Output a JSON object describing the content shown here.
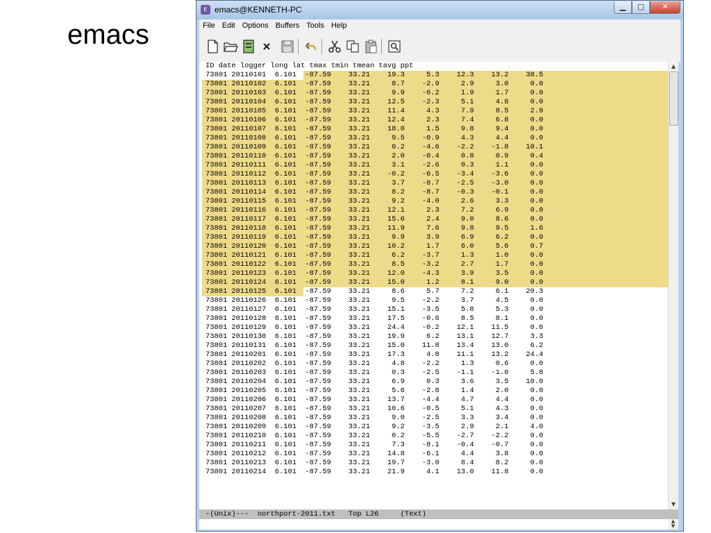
{
  "slide": {
    "title": "emacs"
  },
  "window": {
    "title": "emacs@KENNETH-PC",
    "icon": "emacs-icon",
    "buttons": {
      "minimize": "▁",
      "maximize": "▢",
      "close": "✕"
    }
  },
  "menu": [
    "File",
    "Edit",
    "Options",
    "Buffers",
    "Tools",
    "Help"
  ],
  "toolbar": [
    "new-file-icon",
    "open-folder-icon",
    "dired-icon",
    "close-buffer-icon",
    "save-icon",
    "undo-icon",
    "cut-icon",
    "copy-icon",
    "paste-icon",
    "search-icon"
  ],
  "buffer": {
    "header": "ID date logger long lat tmax tmin tmean tavg ppt",
    "rows": [
      "73801 20110101  6.101  -87.59    33.21    19.3     5.3    12.3    13.2    38.5",
      "73801 20110102  6.101  -87.59    33.21     8.7    -2.9     2.9     3.0     0.0",
      "73801 20110103  6.101  -87.59    33.21     9.9    -6.2     1.9     1.7     0.0",
      "73801 20110104  6.101  -87.59    33.21    12.5    -2.3     5.1     4.8     0.0",
      "73801 20110105  6.101  -87.59    33.21    11.4     4.3     7.9     8.5     2.9",
      "73801 20110106  6.101  -87.59    33.21    12.4     2.3     7.4     6.8     0.0",
      "73801 20110107  6.101  -87.59    33.21    18.0     1.5     9.8     9.4     0.0",
      "73801 20110108  6.101  -87.59    33.21     9.5    -0.9     4.3     4.4     0.0",
      "73801 20110109  6.101  -87.59    33.21     0.2    -4.6    -2.2    -1.8    10.1",
      "73801 20110110  6.101  -87.59    33.21     2.0    -0.4     0.8     0.9     0.4",
      "73801 20110111  6.101  -87.59    33.21     3.1    -2.6     0.3     1.1     0.0",
      "73801 20110112  6.101  -87.59    33.21    -0.2    -6.5    -3.4    -3.6     0.0",
      "73801 20110113  6.101  -87.59    33.21     3.7    -8.7    -2.5    -3.0     0.0",
      "73801 20110114  6.101  -87.59    33.21     8.2    -8.7    -0.3    -0.1     0.0",
      "73801 20110115  6.101  -87.59    33.21     9.2    -4.0     2.6     3.3     0.0",
      "73801 20110116  6.101  -87.59    33.21    12.1     2.3     7.2     6.9     0.0",
      "73801 20110117  6.101  -87.59    33.21    15.6     2.4     9.0     8.6     0.0",
      "73801 20110118  6.101  -87.59    33.21    11.9     7.6     9.8     9.5     1.6",
      "73801 20110119  6.101  -87.59    33.21     9.9     3.9     6.9     6.2     0.0",
      "73801 20110120  6.101  -87.59    33.21    10.2     1.7     6.0     5.6     0.7",
      "73801 20110121  6.101  -87.59    33.21     6.2    -3.7     1.3     1.0     0.0",
      "73801 20110122  6.101  -87.59    33.21     8.5    -3.2     2.7     1.7     0.0",
      "73801 20110123  6.101  -87.59    33.21    12.0    -4.3     3.9     3.5     0.0",
      "73801 20110124  6.101  -87.59    33.21    15.0     1.2     8.1     9.0     0.0",
      "73801 20110125  6.101  -87.59    33.21     8.6     5.7     7.2     6.1    20.3",
      "73801 20110126  6.101  -87.59    33.21     9.5    -2.2     3.7     4.5     0.0",
      "73801 20110127  6.101  -87.59    33.21    15.1    -3.5     5.8     5.3     0.0",
      "73801 20110128  6.101  -87.59    33.21    17.5    -0.6     8.5     8.1     0.0",
      "73801 20110129  6.101  -87.59    33.21    24.4    -0.2    12.1    11.5     0.0",
      "73801 20110130  6.101  -87.59    33.21    19.9     6.2    13.1    12.7     3.3",
      "73801 20110131  6.101  -87.59    33.21    15.0    11.8    13.4    13.0     6.2",
      "73801 20110201  6.101  -87.59    33.21    17.3     4.8    11.1    13.2    24.4",
      "73801 20110202  6.101  -87.59    33.21     4.8    -2.2     1.3     0.6     0.0",
      "73801 20110203  6.101  -87.59    33.21     0.3    -2.5    -1.1    -1.0     5.8",
      "73801 20110204  6.101  -87.59    33.21     6.9     0.3     3.6     3.5    10.0",
      "73801 20110205  6.101  -87.59    33.21     5.6    -2.8     1.4     2.0     0.0",
      "73801 20110206  6.101  -87.59    33.21    13.7    -4.4     4.7     4.4     0.0",
      "73801 20110207  6.101  -87.59    33.21    10.6    -0.5     5.1     4.3     0.0",
      "73801 20110208  6.101  -87.59    33.21     9.0    -2.5     3.3     3.4     0.0",
      "73801 20110209  6.101  -87.59    33.21     9.2    -3.5     2.9     2.1     4.0",
      "73801 20110210  6.101  -87.59    33.21     0.2    -5.5    -2.7    -2.2     0.0",
      "73801 20110211  6.101  -87.59    33.21     7.3    -8.1    -0.4    -0.7     0.0",
      "73801 20110212  6.101  -87.59    33.21    14.8    -6.1     4.4     3.8     0.0",
      "73801 20110213  6.101  -87.59    33.21    19.7    -3.0     8.4     8.2     0.0",
      "73801 20110214  6.101  -87.59    33.21    21.9     4.1    13.0    11.8     0.0"
    ]
  },
  "modeline": "-(Unix)---  northport-2011.txt   Top L26     (Text)",
  "scrollbar": {
    "up": "▲",
    "down": "▼"
  },
  "colors": {
    "region": "#eedb8a",
    "modeline": "#bfbfbf"
  }
}
